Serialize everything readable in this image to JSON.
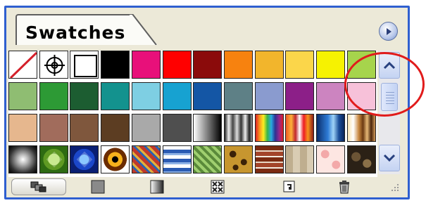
{
  "panel": {
    "tab_label": "Swatches"
  },
  "colors": {
    "frame": "#2f5fd0",
    "highlight_circle": "#e11b1b"
  },
  "swatch_rows": [
    [
      {
        "kind": "none"
      },
      {
        "kind": "registration"
      },
      {
        "kind": "white"
      },
      {
        "kind": "solid",
        "color": "#000000"
      },
      {
        "kind": "solid",
        "color": "#e8107a"
      },
      {
        "kind": "solid",
        "color": "#ff0000"
      },
      {
        "kind": "solid",
        "color": "#8b0b0b"
      },
      {
        "kind": "solid",
        "color": "#f7820f"
      },
      {
        "kind": "solid",
        "color": "#f2b52c"
      },
      {
        "kind": "solid",
        "color": "#fbd64a"
      },
      {
        "kind": "solid",
        "color": "#f6f201"
      },
      {
        "kind": "solid",
        "color": "#a6d44c"
      }
    ],
    [
      {
        "kind": "solid",
        "color": "#8fbd72"
      },
      {
        "kind": "solid",
        "color": "#2d9a35"
      },
      {
        "kind": "solid",
        "color": "#1c5d31"
      },
      {
        "kind": "solid",
        "color": "#13928e"
      },
      {
        "kind": "solid",
        "color": "#7ecfe3"
      },
      {
        "kind": "solid",
        "color": "#17a2d1"
      },
      {
        "kind": "solid",
        "color": "#1456a5"
      },
      {
        "kind": "solid",
        "color": "#5e8086"
      },
      {
        "kind": "solid",
        "color": "#8a9bcf"
      },
      {
        "kind": "solid",
        "color": "#8c1f88"
      },
      {
        "kind": "solid",
        "color": "#cc84c0"
      },
      {
        "kind": "solid",
        "color": "#f7c1d9"
      }
    ],
    [
      {
        "kind": "solid",
        "color": "#e6b78e"
      },
      {
        "kind": "solid",
        "color": "#a16c5c"
      },
      {
        "kind": "solid",
        "color": "#7f573d"
      },
      {
        "kind": "solid",
        "color": "#5c3d22"
      },
      {
        "kind": "solid",
        "color": "#a9a9a9"
      },
      {
        "kind": "solid",
        "color": "#4f4f4f"
      },
      {
        "kind": "gradient",
        "style": "grayscale"
      },
      {
        "kind": "gradient",
        "style": "chrome"
      },
      {
        "kind": "gradient",
        "style": "spectrum"
      },
      {
        "kind": "gradient",
        "style": "warm"
      },
      {
        "kind": "gradient",
        "style": "blue"
      },
      {
        "kind": "gradient",
        "style": "wood"
      }
    ],
    [
      {
        "kind": "pattern",
        "style": "radial-burst"
      },
      {
        "kind": "pattern",
        "style": "green-diamond"
      },
      {
        "kind": "pattern",
        "style": "blue-square"
      },
      {
        "kind": "pattern",
        "style": "target"
      },
      {
        "kind": "pattern",
        "style": "quilt"
      },
      {
        "kind": "pattern",
        "style": "stripes"
      },
      {
        "kind": "pattern",
        "style": "green-tile"
      },
      {
        "kind": "pattern",
        "style": "leopard"
      },
      {
        "kind": "pattern",
        "style": "brick"
      },
      {
        "kind": "pattern",
        "style": "tan-tile"
      },
      {
        "kind": "pattern",
        "style": "pink-floral"
      },
      {
        "kind": "pattern",
        "style": "dark-stone"
      }
    ]
  ],
  "toolbar": [
    {
      "name": "show-swatch-kinds-button",
      "icon": "swatch-kinds-icon"
    },
    {
      "name": "show-color-swatches-button",
      "icon": "color-swatch-icon"
    },
    {
      "name": "show-gradient-swatches-button",
      "icon": "gradient-swatch-icon"
    },
    {
      "name": "show-pattern-swatches-button",
      "icon": "pattern-swatch-icon"
    },
    {
      "name": "new-swatch-button",
      "icon": "new-swatch-icon"
    },
    {
      "name": "delete-swatch-button",
      "icon": "trash-icon"
    }
  ]
}
